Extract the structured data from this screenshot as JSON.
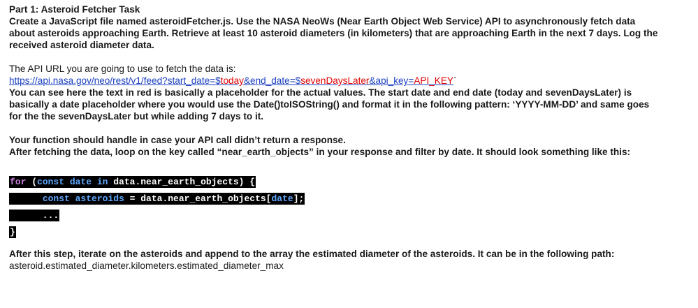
{
  "heading": "Part 1: Asteroid Fetcher Task",
  "intro": [
    "Create a JavaScript file named asteroidFetcher.js. Use the NASA NeoWs (Near Earth Object Web Service) API to asynchronously fetch data",
    "about asteroids approaching Earth. Retrieve at least 10 asteroid diameters (in kilometers) that are approaching Earth in the next 7 days. Log the",
    "received asteroid diameter data."
  ],
  "api_intro": "The API URL you are going to use to fetch the data is:",
  "url": {
    "part1": "https://api.nasa.gov/neo/rest/v1/feed?start_date=$",
    "today": "today",
    "part2": "&end_date=$",
    "seven": "sevenDaysLater",
    "part3": "&api_key=",
    "key": "API_KEY",
    "tail": "`"
  },
  "explain": [
    "You can see here the text in red is basically a placeholder for the actual values. The start date and end date (today and sevenDaysLater) is",
    "basically a date placeholder where you would use the Date()toISOString() and format it in the following pattern: ‘YYYY-MM-DD’ and same goes",
    "for the the sevenDaysLater but while adding 7 days to it."
  ],
  "handle": [
    "Your function should handle in case your API call didn’t return a response.",
    "After fetching the data, loop on the key called “near_earth_objects” in your response and filter by date. It should look something like this:"
  ],
  "code": {
    "l1_for": "for",
    "l1_space": " (",
    "l1_const": "const",
    "l1_date": " date ",
    "l1_in": "in",
    "l1_rest": " data.near_earth_objects) {",
    "l2_indent": "      ",
    "l2_const": "const",
    "l2_ast": " asteroids",
    "l2_rest": " = data.near_earth_objects[",
    "l2_date": "date",
    "l2_end": "];",
    "l3": "      ...",
    "l4": "}"
  },
  "after": [
    "After this step, iterate on the asteroids and append to the array the estimated diameter of the asteroids. It can be in the following path:",
    "asteroid.estimated_diameter.kilometers.estimated_diameter_max"
  ]
}
